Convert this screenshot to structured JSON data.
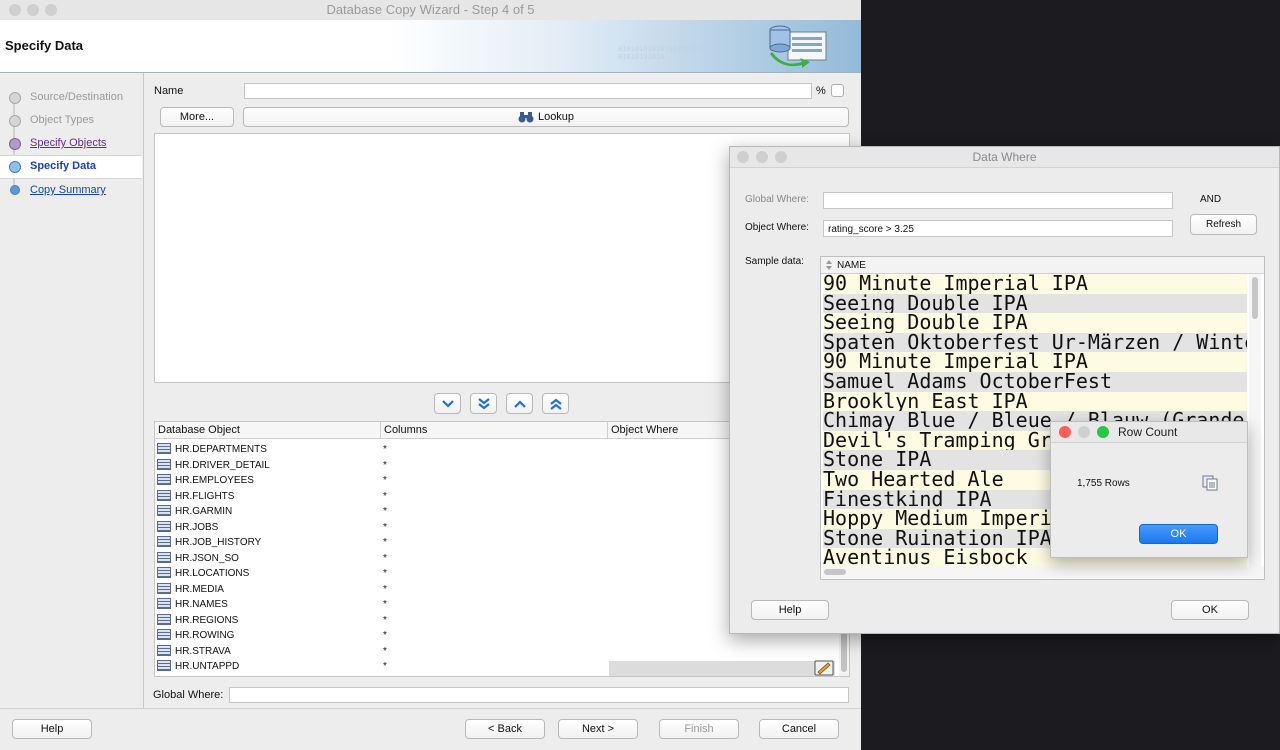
{
  "main_window": {
    "title": "Database Copy Wizard - Step 4 of 5",
    "banner_title": "Specify Data",
    "banner_bits": "01010101010101010101010\n01010101010"
  },
  "nav": {
    "items": [
      {
        "label": "Source/Destination"
      },
      {
        "label": "Object Types"
      },
      {
        "label": "Specify Objects"
      },
      {
        "label": "Specify Data"
      },
      {
        "label": "Copy Summary"
      }
    ]
  },
  "filter": {
    "name_label": "Name",
    "name_value": "",
    "percent": "%",
    "more_button": "More...",
    "lookup_button": "Lookup"
  },
  "grid": {
    "headers": [
      "Database Object",
      "Columns",
      "Object Where"
    ],
    "rows": [
      {
        "object": "HR.DEPARTMENTS",
        "columns": "*"
      },
      {
        "object": "HR.DRIVER_DETAIL",
        "columns": "*"
      },
      {
        "object": "HR.EMPLOYEES",
        "columns": "*"
      },
      {
        "object": "HR.FLIGHTS",
        "columns": "*"
      },
      {
        "object": "HR.GARMIN",
        "columns": "*"
      },
      {
        "object": "HR.JOBS",
        "columns": "*"
      },
      {
        "object": "HR.JOB_HISTORY",
        "columns": "*"
      },
      {
        "object": "HR.JSON_SO",
        "columns": "*"
      },
      {
        "object": "HR.LOCATIONS",
        "columns": "*"
      },
      {
        "object": "HR.MEDIA",
        "columns": "*"
      },
      {
        "object": "HR.NAMES",
        "columns": "*"
      },
      {
        "object": "HR.REGIONS",
        "columns": "*"
      },
      {
        "object": "HR.ROWING",
        "columns": "*"
      },
      {
        "object": "HR.STRAVA",
        "columns": "*"
      },
      {
        "object": "HR.UNTAPPD",
        "columns": "*"
      }
    ]
  },
  "global_where": {
    "label": "Global Where:",
    "value": ""
  },
  "footer": {
    "help": "Help",
    "back": "< Back",
    "next": "Next >",
    "finish": "Finish",
    "cancel": "Cancel"
  },
  "data_where": {
    "title": "Data Where",
    "global_where_label": "Global Where:",
    "global_where_value": "",
    "and_label": "AND",
    "object_where_label": "Object Where:",
    "object_where_value": "rating_score > 3.25",
    "refresh": "Refresh",
    "sample_label": "Sample data:",
    "sample_header": "NAME",
    "sample_rows": [
      "90 Minute Imperial IPA",
      "Seeing Double IPA",
      "Seeing Double IPA",
      "Spaten Oktoberfest Ur-Märzen / Winte",
      "90 Minute Imperial IPA",
      "Samuel Adams OctoberFest",
      "Brooklyn East IPA",
      "Chimay Blue / Bleue / Blauw (Grande R",
      "Devil's Tramping Gro",
      "Stone IPA",
      "Two Hearted Ale",
      "Finestkind IPA",
      "Hoppy Medium Imperia",
      "Stone Ruination IPA",
      "Aventinus Eisbock"
    ],
    "help": "Help",
    "ok": "OK"
  },
  "row_count": {
    "title": "Row Count",
    "text": "1,755 Rows",
    "ok": "OK"
  },
  "colors": {
    "accent_blue": "#1a78f0",
    "row_yellow": "#fdfbe1",
    "row_gray": "#e3e3e3",
    "nav_selected": "#ffffff",
    "link": "#1a43a8",
    "visited_link": "#6a2c8a"
  }
}
